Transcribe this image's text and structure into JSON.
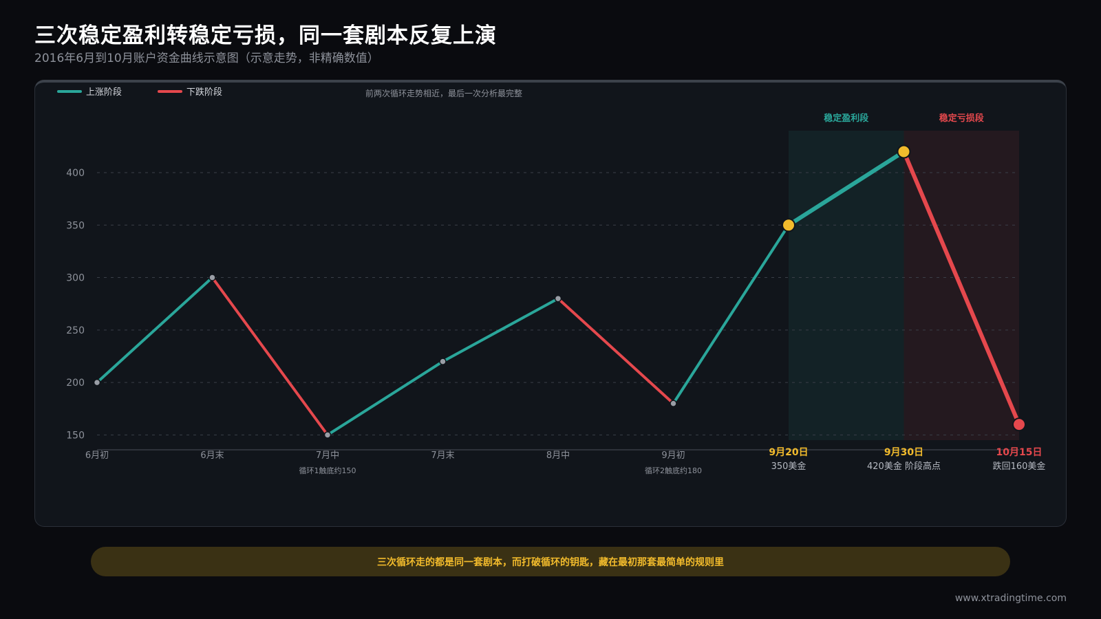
{
  "header": {
    "title": "三次稳定盈利转稳定亏损，同一套剧本反复上演",
    "subtitle": "2016年6月到10月账户资金曲线示意图（示意走势，非精确数值）"
  },
  "chart_data": {
    "type": "line",
    "ylim": [
      145,
      440
    ],
    "y_ticks": [
      150,
      200,
      250,
      300,
      350,
      400
    ],
    "grid": true,
    "legend_position": "top-left",
    "legend": [
      {
        "label": "上涨阶段",
        "color": "#2aa69a"
      },
      {
        "label": "下跌阶段",
        "color": "#e5484d"
      }
    ],
    "note": "前两次循环走势相近，最后一次分析最完整",
    "zones": [
      {
        "label": "稳定盈利段",
        "from": 6,
        "to": 7,
        "color": "#2aa69a"
      },
      {
        "label": "稳定亏损段",
        "from": 7,
        "to": 8,
        "color": "#e5484d"
      }
    ],
    "points": [
      {
        "label": "6月初",
        "value": 200
      },
      {
        "label": "6月末",
        "value": 300
      },
      {
        "label": "7月中",
        "value": 150,
        "sublabel": "循环1触底约150"
      },
      {
        "label": "7月末",
        "value": 220
      },
      {
        "label": "8月中",
        "value": 280
      },
      {
        "label": "9月初",
        "value": 180,
        "sublabel": "循环2触底约180"
      },
      {
        "label": "9月20日",
        "value": 350,
        "sublabel": "350美金",
        "highlight": "gold"
      },
      {
        "label": "9月30日",
        "value": 420,
        "sublabel": "420美金 阶段高点",
        "highlight": "gold"
      },
      {
        "label": "10月15日",
        "value": 160,
        "sublabel": "跌回160美金",
        "highlight": "red"
      }
    ],
    "colors": {
      "up": "#2aa69a",
      "down": "#e5484d",
      "gold": "#f2bb2c",
      "grey_point": "#9a9ea6"
    }
  },
  "callout": {
    "text": "三次循环走的都是同一套剧本，而打破循环的钥匙，藏在最初那套最简单的规则里"
  },
  "footer": {
    "url": "www.xtradingtime.com"
  }
}
